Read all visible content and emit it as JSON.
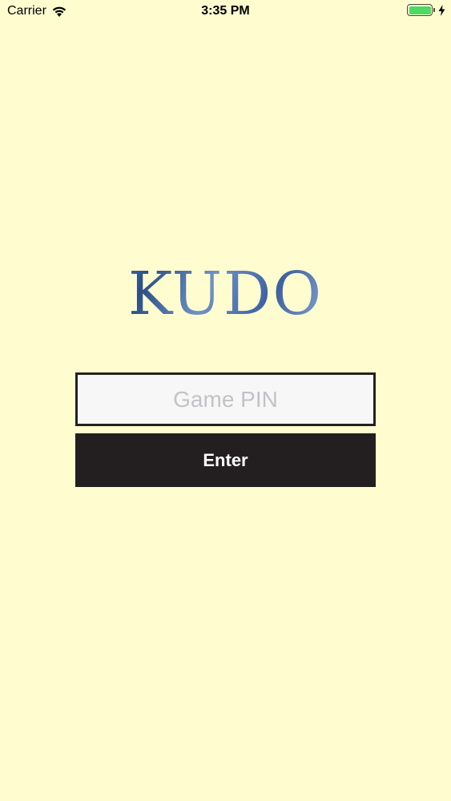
{
  "status_bar": {
    "carrier": "Carrier",
    "time": "3:35 PM",
    "battery_color": "#4cd964"
  },
  "logo": {
    "text": "KUDO",
    "color": "#39609a"
  },
  "pin_input": {
    "placeholder": "Game PIN",
    "value": ""
  },
  "enter_button": {
    "label": "Enter"
  },
  "colors": {
    "background": "#fffdcf",
    "button_background": "#231f20",
    "input_border": "#222222"
  }
}
